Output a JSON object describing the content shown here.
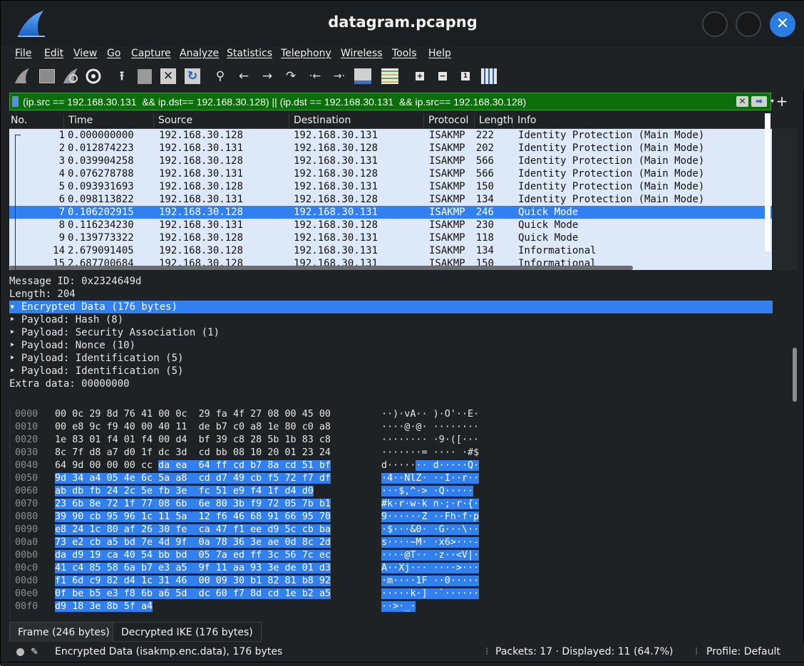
{
  "window": {
    "title": "datagram.pcapng"
  },
  "menu": [
    "File",
    "Edit",
    "View",
    "Go",
    "Capture",
    "Analyze",
    "Statistics",
    "Telephony",
    "Wireless",
    "Tools",
    "Help"
  ],
  "filter": {
    "value": "(ip.src == 192.168.30.131  && ip.dst== 192.168.30.128) || (ip.dst == 192.168.30.131  && ip.src== 192.168.30.128)"
  },
  "packet_list": {
    "columns": [
      "No.",
      "Time",
      "Source",
      "Destination",
      "Protocol",
      "Length",
      "Info"
    ],
    "rows": [
      {
        "no": "1",
        "time": "0.000000000",
        "src": "192.168.30.128",
        "dst": "192.168.30.131",
        "proto": "ISAKMP",
        "len": "222",
        "info": "Identity Protection (Main Mode)"
      },
      {
        "no": "2",
        "time": "0.012874223",
        "src": "192.168.30.131",
        "dst": "192.168.30.128",
        "proto": "ISAKMP",
        "len": "202",
        "info": "Identity Protection (Main Mode)"
      },
      {
        "no": "3",
        "time": "0.039904258",
        "src": "192.168.30.128",
        "dst": "192.168.30.131",
        "proto": "ISAKMP",
        "len": "566",
        "info": "Identity Protection (Main Mode)"
      },
      {
        "no": "4",
        "time": "0.076278788",
        "src": "192.168.30.131",
        "dst": "192.168.30.128",
        "proto": "ISAKMP",
        "len": "566",
        "info": "Identity Protection (Main Mode)"
      },
      {
        "no": "5",
        "time": "0.093931693",
        "src": "192.168.30.128",
        "dst": "192.168.30.131",
        "proto": "ISAKMP",
        "len": "150",
        "info": "Identity Protection (Main Mode)"
      },
      {
        "no": "6",
        "time": "0.098113822",
        "src": "192.168.30.131",
        "dst": "192.168.30.128",
        "proto": "ISAKMP",
        "len": "134",
        "info": "Identity Protection (Main Mode)"
      },
      {
        "no": "7",
        "time": "0.106202915",
        "src": "192.168.30.128",
        "dst": "192.168.30.131",
        "proto": "ISAKMP",
        "len": "246",
        "info": "Quick Mode",
        "selected": true
      },
      {
        "no": "8",
        "time": "0.116234230",
        "src": "192.168.30.131",
        "dst": "192.168.30.128",
        "proto": "ISAKMP",
        "len": "230",
        "info": "Quick Mode"
      },
      {
        "no": "9",
        "time": "0.139773322",
        "src": "192.168.30.128",
        "dst": "192.168.30.131",
        "proto": "ISAKMP",
        "len": "118",
        "info": "Quick Mode"
      },
      {
        "no": "14",
        "time": "2.679091405",
        "src": "192.168.30.128",
        "dst": "192.168.30.131",
        "proto": "ISAKMP",
        "len": "134",
        "info": "Informational"
      },
      {
        "no": "15",
        "time": "2.687700684",
        "src": "192.168.30.128",
        "dst": "192.168.30.131",
        "proto": "ISAKMP",
        "len": "150",
        "info": "Informational"
      }
    ]
  },
  "details": {
    "lines": [
      {
        "text": "    Message ID: 0x2324649d"
      },
      {
        "text": "    Length: 204"
      },
      {
        "text": "  ▾ Encrypted Data (176 bytes)",
        "selected": true
      },
      {
        "text": "      ‣ Payload: Hash (8)"
      },
      {
        "text": "      ‣ Payload: Security Association (1)"
      },
      {
        "text": "      ‣ Payload: Nonce (10)"
      },
      {
        "text": "      ‣ Payload: Identification (5)"
      },
      {
        "text": "      ‣ Payload: Identification (5)"
      },
      {
        "text": "      Extra data: 00000000"
      }
    ]
  },
  "bytes": {
    "rows": [
      {
        "off": "0000",
        "hex": [
          "00",
          "0c",
          "29",
          "8d",
          "76",
          "41",
          "00",
          "0c",
          "29",
          "fa",
          "4f",
          "27",
          "08",
          "00",
          "45",
          "00"
        ],
        "ascii": "··)·vA··)·O'··E·"
      },
      {
        "off": "0010",
        "hex": [
          "00",
          "e8",
          "9c",
          "f9",
          "40",
          "00",
          "40",
          "11",
          "de",
          "b7",
          "c0",
          "a8",
          "1e",
          "80",
          "c0",
          "a8"
        ],
        "ascii": "····@·@·········"
      },
      {
        "off": "0020",
        "hex": [
          "1e",
          "83",
          "01",
          "f4",
          "01",
          "f4",
          "00",
          "d4",
          "bf",
          "39",
          "c8",
          "28",
          "5b",
          "1b",
          "83",
          "c8"
        ],
        "ascii": "·········9·([···"
      },
      {
        "off": "0030",
        "hex": [
          "8c",
          "7f",
          "d8",
          "a7",
          "d0",
          "1f",
          "dc",
          "3d",
          "cd",
          "bb",
          "08",
          "10",
          "20",
          "01",
          "23",
          "24"
        ],
        "ascii": "·······=···· ·#$"
      },
      {
        "off": "0040",
        "hex": [
          "64",
          "9d",
          "00",
          "00",
          "00",
          "cc",
          "da",
          "ea",
          "64",
          "ff",
          "cd",
          "b7",
          "8a",
          "cd",
          "51",
          "bf"
        ],
        "ascii": "d·······d·····Q·"
      },
      {
        "off": "0050",
        "hex": [
          "9d",
          "34",
          "a4",
          "05",
          "4e",
          "6c",
          "5a",
          "a8",
          "cd",
          "d7",
          "49",
          "cb",
          "f5",
          "72",
          "f7",
          "df"
        ],
        "ascii": "·4··NlZ···I··r··"
      },
      {
        "off": "0060",
        "hex": [
          "ab",
          "db",
          "fb",
          "24",
          "2c",
          "5e",
          "fb",
          "3e",
          "fc",
          "51",
          "e9",
          "f4",
          "1f",
          "d4",
          "d0"
        ],
        "ascii": "···$,^·>·Q·····"
      },
      {
        "off": "0070",
        "hex": [
          "23",
          "6b",
          "8e",
          "72",
          "1f",
          "77",
          "08",
          "6b",
          "6e",
          "80",
          "3b",
          "f9",
          "72",
          "05",
          "7b",
          "b1"
        ],
        "ascii": "#k·r·w·kn·;·r·{·"
      },
      {
        "off": "0080",
        "hex": [
          "39",
          "90",
          "cb",
          "95",
          "96",
          "1c",
          "11",
          "5a",
          "12",
          "f6",
          "46",
          "68",
          "91",
          "66",
          "95",
          "70"
        ],
        "ascii": "9······Z··Fh·f·p"
      },
      {
        "off": "0090",
        "hex": [
          "e8",
          "24",
          "1c",
          "80",
          "af",
          "26",
          "30",
          "fe",
          "ca",
          "47",
          "f1",
          "ee",
          "d9",
          "5c",
          "cb",
          "ba"
        ],
        "ascii": "·$···&0··G···\\··"
      },
      {
        "off": "00a0",
        "hex": [
          "73",
          "e2",
          "cb",
          "a5",
          "bd",
          "7e",
          "4d",
          "9f",
          "0a",
          "78",
          "36",
          "3e",
          "ae",
          "0d",
          "8c",
          "2d"
        ],
        "ascii": "s····~M··x6>···-"
      },
      {
        "off": "00b0",
        "hex": [
          "da",
          "d9",
          "19",
          "ca",
          "40",
          "54",
          "bb",
          "bd",
          "05",
          "7a",
          "ed",
          "ff",
          "3c",
          "56",
          "7c",
          "ec"
        ],
        "ascii": "····@T···z··<V|·"
      },
      {
        "off": "00c0",
        "hex": [
          "41",
          "c4",
          "85",
          "58",
          "6a",
          "b7",
          "e3",
          "a5",
          "9f",
          "11",
          "aa",
          "93",
          "3e",
          "de",
          "01",
          "d3"
        ],
        "ascii": "A··Xj·······>···"
      },
      {
        "off": "00d0",
        "hex": [
          "f1",
          "6d",
          "c9",
          "82",
          "d4",
          "1c",
          "31",
          "46",
          "00",
          "09",
          "30",
          "b1",
          "82",
          "81",
          "b8",
          "92"
        ],
        "ascii": "·m····1F··0·····"
      },
      {
        "off": "00e0",
        "hex": [
          "0f",
          "be",
          "b5",
          "e3",
          "f8",
          "6b",
          "a6",
          "5d",
          "dc",
          "60",
          "f7",
          "8d",
          "cd",
          "1e",
          "b2",
          "a5"
        ],
        "ascii": "·····k·]·`······"
      },
      {
        "off": "00f0",
        "hex": [
          "d9",
          "18",
          "3e",
          "8b",
          "5f",
          "a4"
        ],
        "ascii": "··>·_·"
      }
    ]
  },
  "tabs": [
    "Frame (246 bytes)",
    "Decrypted IKE (176 bytes)"
  ],
  "status": {
    "field": "Encrypted Data (isakmp.enc.data), 176 bytes",
    "packets": "Packets: 17 · Displayed: 11 (64.7%)",
    "profile": "Profile: Default"
  },
  "colors": {
    "selection": "#3280f0",
    "filter_ok": "#0b6e0b",
    "row_bg": "#dde9f8",
    "window_bg": "#1f2224"
  },
  "icons": [
    "shark-fin-icon",
    "start-capture-icon",
    "stop-capture-icon",
    "restart-capture-icon",
    "options-gear-icon",
    "open-file-icon",
    "save-file-icon",
    "close-file-icon",
    "reload-icon",
    "find-icon",
    "back-icon",
    "forward-icon",
    "goto-icon",
    "first-icon",
    "last-icon",
    "autoscroll-icon",
    "colorize-icon",
    "zoom-in-icon",
    "zoom-out-icon",
    "normal-size-icon",
    "resize-columns-icon"
  ]
}
